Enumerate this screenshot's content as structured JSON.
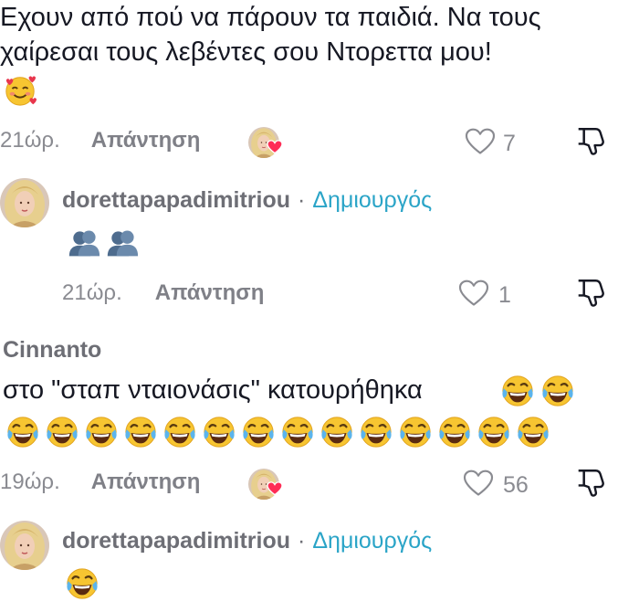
{
  "comments": [
    {
      "text_line1": "Εχουν από πού να πάρουν τα παιδιά. Να τους",
      "text_line2": "χαίρεσαι τους λεβέντες σου Ντορεττα μου!",
      "emoji": "smiling-face-with-hearts",
      "time": "21ώρ.",
      "reply_label": "Απάντηση",
      "likes": "7"
    },
    {
      "username": "dorettapapadimitriou",
      "separator": "·",
      "badge": "Δημιουργός",
      "emoji": "busts-in-silhouette x2",
      "time": "21ώρ.",
      "reply_label": "Απάντηση",
      "likes": "1"
    },
    {
      "username": "Cinnanto",
      "text": "στο \"σταπ νταιονάσις\" κατουρήθηκα",
      "emoji": "face-with-tears-of-joy x16",
      "time": "19ώρ.",
      "reply_label": "Απάντηση",
      "likes": "56"
    },
    {
      "username": "dorettapapadimitriou",
      "separator": "·",
      "badge": "Δημιουργός",
      "emoji": "face-with-tears-of-joy"
    }
  ],
  "colors": {
    "text": "#161823",
    "meta": "#8a8b91",
    "creator_badge": "#2aa4c7",
    "liked_heart": "#fe2c55"
  }
}
